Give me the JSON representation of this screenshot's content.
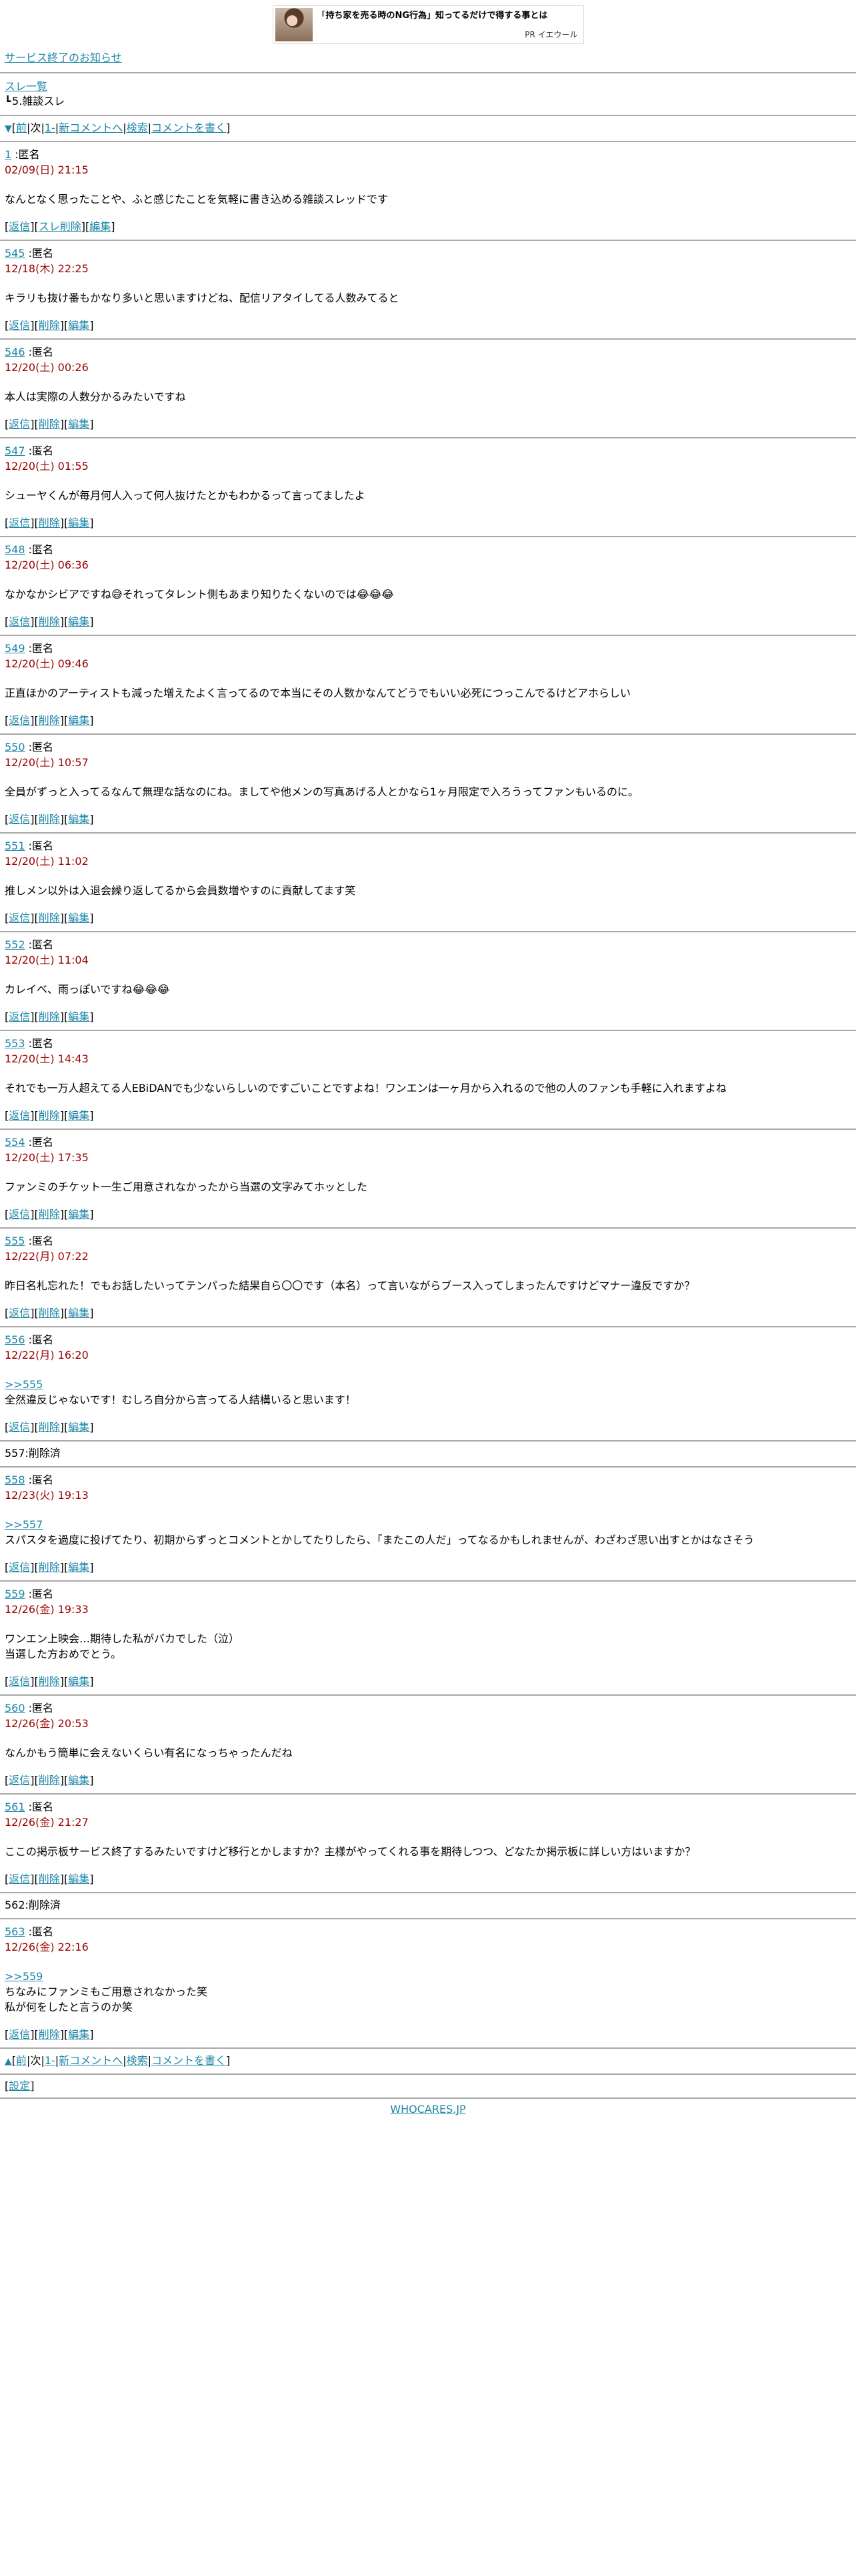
{
  "ad": {
    "title": "「持ち家を売る時のNG行為」知ってるだけで得する事とは",
    "sponsor": "PR イエウール"
  },
  "notice_link": "サービス終了のお知らせ",
  "breadcrumb": {
    "list_link": "スレ一覧",
    "corner_glyph": "┗",
    "thread_title": "5.雑談スレ"
  },
  "nav_top": {
    "arrow": "▼",
    "front": "前",
    "next": "次",
    "first": "1-",
    "new": "新コメントへ",
    "search": "検索",
    "write": "コメントを書く"
  },
  "nav_bottom": {
    "arrow": "▲",
    "front": "前",
    "next": "次",
    "first": "1-",
    "new": "新コメントへ",
    "search": "検索",
    "write": "コメントを書く"
  },
  "labels": {
    "reply": "返信",
    "delete": "削除",
    "edit": "編集",
    "thread_delete": "スレ削除",
    "settings": "設定"
  },
  "posts": [
    {
      "type": "post",
      "num": "1",
      "name": ":匿名",
      "date": "02/09(日) 21:15",
      "body": "なんとなく思ったことや、ふと感じたことを気軽に書き込める雑談スレッドです",
      "op": true
    },
    {
      "type": "post",
      "num": "545",
      "name": ":匿名",
      "date": "12/18(木) 22:25",
      "body": "キラリも抜け番もかなり多いと思いますけどね、配信リアタイしてる人数みてると"
    },
    {
      "type": "post",
      "num": "546",
      "name": ":匿名",
      "date": "12/20(土) 00:26",
      "body": "本人は実際の人数分かるみたいですね"
    },
    {
      "type": "post",
      "num": "547",
      "name": ":匿名",
      "date": "12/20(土) 01:55",
      "body": "シューヤくんが毎月何人入って何人抜けたとかもわかるって言ってましたよ"
    },
    {
      "type": "post",
      "num": "548",
      "name": ":匿名",
      "date": "12/20(土) 06:36",
      "body": "なかなかシビアですね😅それってタレント側もあまり知りたくないのでは😂😂😂"
    },
    {
      "type": "post",
      "num": "549",
      "name": ":匿名",
      "date": "12/20(土) 09:46",
      "body": "正直ほかのアーティストも減った増えたよく言ってるので本当にその人数かなんてどうでもいい必死につっこんでるけどアホらしい"
    },
    {
      "type": "post",
      "num": "550",
      "name": ":匿名",
      "date": "12/20(土) 10:57",
      "body": "全員がずっと入ってるなんて無理な話なのにね。ましてや他メンの写真あげる人とかなら1ヶ月限定で入ろうってファンもいるのに。"
    },
    {
      "type": "post",
      "num": "551",
      "name": ":匿名",
      "date": "12/20(土) 11:02",
      "body": "推しメン以外は入退会繰り返してるから会員数増やすのに貢献してます笑"
    },
    {
      "type": "post",
      "num": "552",
      "name": ":匿名",
      "date": "12/20(土) 11:04",
      "body": "カレイベ、雨っぽいですね😂😂😂"
    },
    {
      "type": "post",
      "num": "553",
      "name": ":匿名",
      "date": "12/20(土) 14:43",
      "body": "それでも一万人超えてる人EBiDANでも少ないらしいのですごいことですよね！ワンエンは一ヶ月から入れるので他の人のファンも手軽に入れますよね"
    },
    {
      "type": "post",
      "num": "554",
      "name": ":匿名",
      "date": "12/20(土) 17:35",
      "body": "ファンミのチケット一生ご用意されなかったから当選の文字みてホッとした"
    },
    {
      "type": "post",
      "num": "555",
      "name": ":匿名",
      "date": "12/22(月) 07:22",
      "body": "昨日名札忘れた！でもお話したいってテンパった結果自ら〇〇です（本名）って言いながらブース入ってしまったんですけどマナー違反ですか？"
    },
    {
      "type": "post",
      "num": "556",
      "name": ":匿名",
      "date": "12/22(月) 16:20",
      "anchor": ">>555",
      "body": "全然違反じゃないです！むしろ自分から言ってる人結構いると思います！"
    },
    {
      "type": "deleted",
      "text": "557:削除済"
    },
    {
      "type": "post",
      "num": "558",
      "name": ":匿名",
      "date": "12/23(火) 19:13",
      "anchor": ">>557",
      "body": "スパスタを過度に投げてたり、初期からずっとコメントとかしてたりしたら、「またこの人だ」ってなるかもしれませんが、わざわざ思い出すとかはなさそう"
    },
    {
      "type": "post",
      "num": "559",
      "name": ":匿名",
      "date": "12/26(金) 19:33",
      "body": "ワンエン上映会…期待した私がバカでした（泣）\n当選した方おめでとう。"
    },
    {
      "type": "post",
      "num": "560",
      "name": ":匿名",
      "date": "12/26(金) 20:53",
      "body": "なんかもう簡単に会えないくらい有名になっちゃったんだね"
    },
    {
      "type": "post",
      "num": "561",
      "name": ":匿名",
      "date": "12/26(金) 21:27",
      "body": "ここの掲示板サービス終了するみたいですけど移行とかしますか？主様がやってくれる事を期待しつつ、どなたか掲示板に詳しい方はいますか？"
    },
    {
      "type": "deleted",
      "text": "562:削除済"
    },
    {
      "type": "post",
      "num": "563",
      "name": ":匿名",
      "date": "12/26(金) 22:16",
      "anchor": ">>559",
      "body": "ちなみにファンミもご用意されなかった笑\n私が何をしたと言うのか笑"
    }
  ],
  "footer_link": "WHOCARES.JP",
  "colors": {
    "link": "#1e87a8",
    "date": "#990000",
    "separator": "#aaaaaa"
  }
}
